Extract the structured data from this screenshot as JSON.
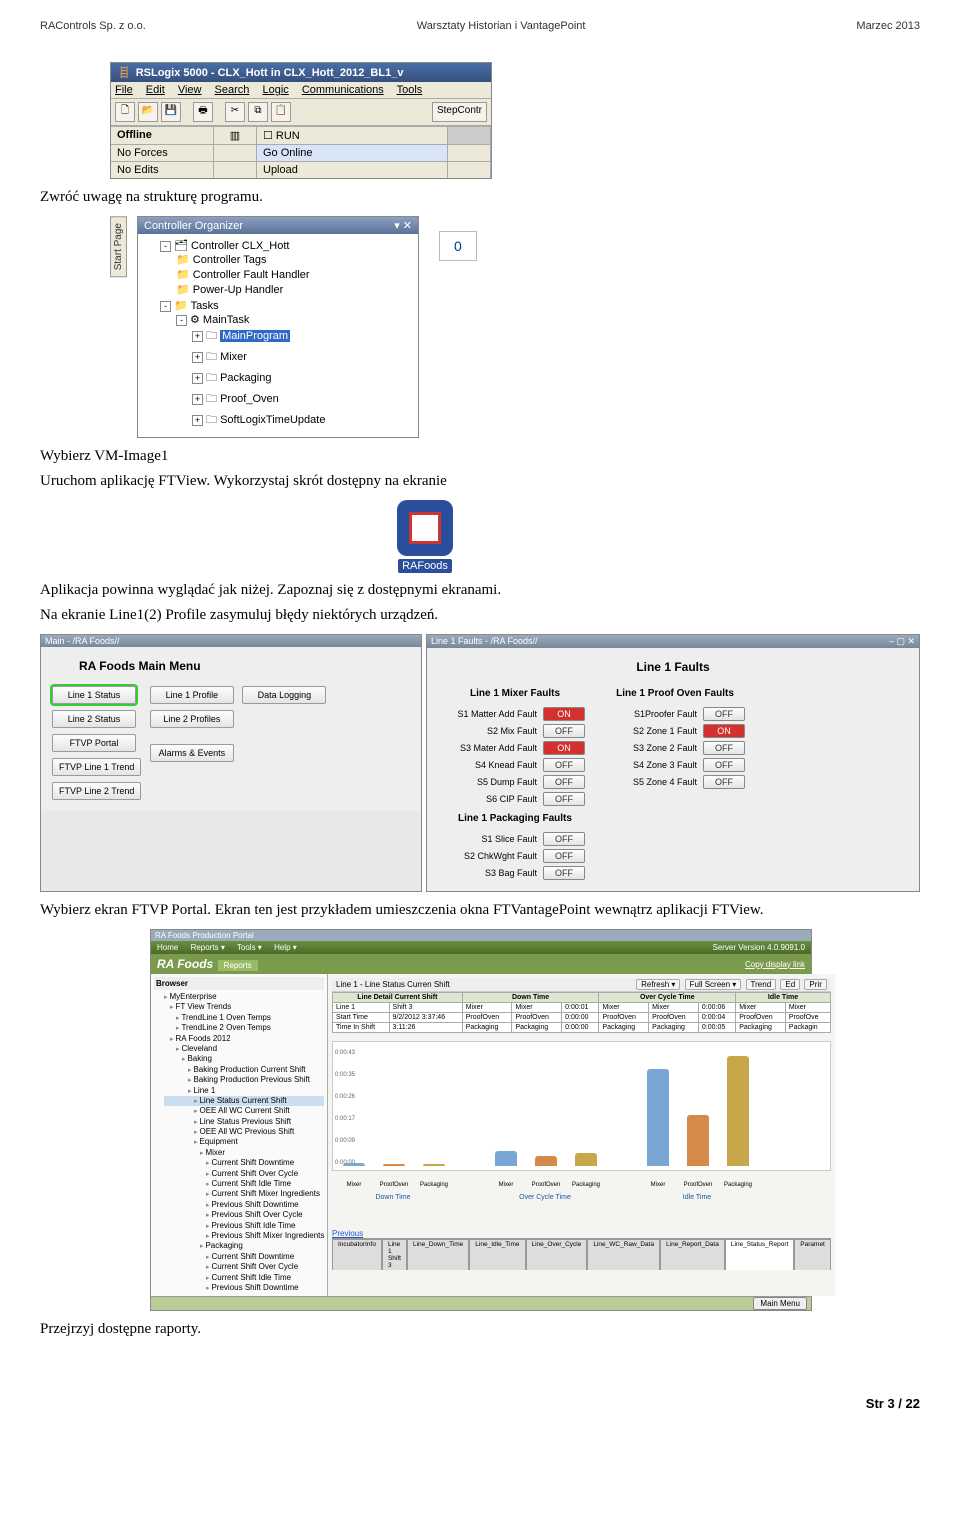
{
  "header": {
    "left": "RAControls Sp. z o.o.",
    "center": "Warsztaty  Historian i VantagePoint",
    "right": "Marzec 2013"
  },
  "rslogix": {
    "title": "RSLogix 5000 - CLX_Hott in CLX_Hott_2012_BL1_v",
    "menu": [
      "File",
      "Edit",
      "View",
      "Search",
      "Logic",
      "Communications",
      "Tools"
    ],
    "toolbar_right_btn": "StepContr",
    "status": {
      "offline": "Offline",
      "run": "RUN",
      "noforces": "No Forces",
      "goonline": "Go Online",
      "noedits": "No Edits",
      "upload": "Upload"
    }
  },
  "para1": "Zwróć uwagę na strukturę programu.",
  "organizer": {
    "start_tab": "Start Page",
    "title": "Controller Organizer",
    "pin_glyphs": "▾ ✕",
    "tree": {
      "controller": "Controller CLX_Hott",
      "items": [
        "Controller Tags",
        "Controller Fault Handler",
        "Power-Up Handler"
      ],
      "tasks": "Tasks",
      "maintask": "MainTask",
      "programs": [
        "MainProgram",
        "Mixer",
        "Packaging",
        "Proof_Oven",
        "SoftLogixTimeUpdate"
      ]
    },
    "side_value": "0"
  },
  "para2a": "Wybierz VM-Image1",
  "para2b": "Uruchom aplikację FTView. Wykorzystaj skrót dostępny na ekranie",
  "rafoods_label": "RAFoods",
  "para3a": "Aplikacja powinna wyglądać jak niżej. Zapoznaj się z dostępnymi ekranami.",
  "para3b": "Na ekranie Line1(2) Profile zasymuluj błędy niektórych urządzeń.",
  "ftview_left": {
    "title_prefix": "Main - /RA Foods//",
    "heading": "RA Foods Main Menu",
    "col1": [
      "Line 1 Status",
      "Line 2 Status",
      "FTVP Portal",
      "FTVP Line 1 Trend",
      "FTVP Line 2 Trend"
    ],
    "col2": [
      "Line 1 Profile",
      "Line 2 Profiles",
      "Alarms & Events"
    ],
    "col3": [
      "Data Logging"
    ]
  },
  "ftview_right": {
    "title_prefix": "Line 1 Faults - /RA Foods//",
    "heading": "Line 1 Faults",
    "groups": [
      {
        "title": "Line 1 Mixer Faults",
        "rows": [
          {
            "lbl": "S1 Matter Add Fault",
            "state": "ON"
          },
          {
            "lbl": "S2 Mix Fault",
            "state": "OFF"
          },
          {
            "lbl": "S3 Mater Add Fault",
            "state": "ON"
          },
          {
            "lbl": "S4 Knead Fault",
            "state": "OFF"
          },
          {
            "lbl": "S5 Dump Fault",
            "state": "OFF"
          },
          {
            "lbl": "S6 CIP Fault",
            "state": "OFF"
          }
        ]
      },
      {
        "title": "Line 1 Proof Oven Faults",
        "rows": [
          {
            "lbl": "S1Proofer Fault",
            "state": "OFF"
          },
          {
            "lbl": "S2 Zone 1 Fault",
            "state": "ON"
          },
          {
            "lbl": "S3 Zone 2 Fault",
            "state": "OFF"
          },
          {
            "lbl": "S4 Zone 3 Fault",
            "state": "OFF"
          },
          {
            "lbl": "S5 Zone 4 Fault",
            "state": "OFF"
          }
        ]
      },
      {
        "title": "Line 1 Packaging Faults",
        "rows": [
          {
            "lbl": "S1 Slice Fault",
            "state": "OFF"
          },
          {
            "lbl": "S2 ChkWght Fault",
            "state": "OFF"
          },
          {
            "lbl": "S3 Bag Fault",
            "state": "OFF"
          }
        ]
      }
    ]
  },
  "para4": "Wybierz ekran FTVP Portal. Ekran ten jest przykładem umieszczenia okna FTVantagePoint wewnątrz aplikacji FTView.",
  "portal": {
    "wintitle": "RA Foods Production Portal",
    "menus": [
      "Home",
      "Reports ▾",
      "Tools ▾",
      "Help ▾"
    ],
    "server_ver": "Server Version 4.0.9091.0",
    "brand": "RA Foods",
    "brand_sub": "Reports",
    "copy_link": "Copy display link",
    "browser_hdr": "Browser",
    "tree": [
      "MyEnterprise",
      " FT View Trends",
      "  TrendLine 1 Oven Temps",
      "  TrendLine 2 Oven Temps",
      " RA Foods 2012",
      "  Cleveland",
      "   Baking",
      "    Baking Production Current Shift",
      "    Baking Production Previous Shift",
      "    Line 1",
      "     Line Status Current Shift",
      "     OEE All WC Current Shift",
      "     Line Status Previous Shift",
      "     OEE All WC Previous Shift",
      "     Equipment",
      "      Mixer",
      "       Current Shift Downtime",
      "       Current Shift Over Cycle",
      "       Current Shift Idle Time",
      "       Current Shift Mixer Ingredients",
      "       Previous Shift Downtime",
      "       Previous Shift Over Cycle",
      "       Previous Shift Idle Time",
      "       Previous Shift Mixer Ingredients",
      "      Packaging",
      "       Current Shift Downtime",
      "       Current Shift Over Cycle",
      "       Current Shift Idle Time",
      "       Previous Shift Downtime"
    ],
    "tree_selected_idx": 10,
    "toolbar": {
      "left": "Line 1 - Line Status Curren Shift",
      "refresh": "Refresh ▾",
      "fullscreen": "Full Screen ▾",
      "trend": "Trend",
      "edit": "Ed",
      "print": "Prir"
    },
    "detail": {
      "headers": [
        "Line Detail Current Shift",
        "Down Time",
        "Over Cycle Time",
        "Idle Time"
      ],
      "rows": [
        [
          "Line 1",
          "Shift 3",
          "Mixer",
          "Mixer",
          "0:00:01",
          "Mixer",
          "Mixer",
          "0:00:06",
          "Mixer",
          "Mixer"
        ],
        [
          "Start Time",
          "9/2/2012 3:37:46",
          "ProofOven",
          "ProofOven",
          "0:00:00",
          "ProofOven",
          "ProofOven",
          "0:00:04",
          "ProofOven",
          "ProofOve"
        ],
        [
          "Time In Shift",
          "3:11:26",
          "Packaging",
          "Packaging",
          "0:00:00",
          "Packaging",
          "Packaging",
          "0:00:05",
          "Packaging",
          "Packagin"
        ]
      ]
    },
    "ylabels": [
      "0:00:43",
      "0:00:35",
      "0:00:26",
      "0:00:17",
      "0:00:09",
      "0:00:00"
    ],
    "prev": "Previous",
    "tabs": [
      "IncubatorInfo",
      "Line 1 Shift 3",
      "Line_Down_Time",
      "Line_Idle_Time",
      "Line_Over_Cycle",
      "Line_WC_Raw_Data",
      "Line_Report_Data",
      "Line_Status_Report",
      "Paramet"
    ],
    "active_tab_idx": 7,
    "main_menu_btn": "Main Menu"
  },
  "chart_data": {
    "type": "bar",
    "title": "",
    "y_format": "duration_seconds",
    "groups": [
      {
        "name": "Down Time",
        "categories": [
          "Mixer",
          "ProofOven",
          "Packaging"
        ],
        "values_sec": [
          1,
          0,
          0
        ],
        "colors": [
          "#7aa6d6",
          "#d68a4a",
          "#c7a74a"
        ]
      },
      {
        "name": "Over Cycle Time",
        "categories": [
          "Mixer",
          "ProofOven",
          "Packaging"
        ],
        "values_sec": [
          6,
          4,
          5
        ],
        "colors": [
          "#7aa6d6",
          "#d68a4a",
          "#c7a74a"
        ]
      },
      {
        "name": "Idle Time",
        "categories": [
          "Mixer",
          "ProofOven",
          "Packaging"
        ],
        "values_sec": [
          38,
          20,
          43
        ],
        "colors": [
          "#7aa6d6",
          "#d68a4a",
          "#c7a74a"
        ]
      }
    ],
    "ymax_sec": 43
  },
  "para5": "Przejrzyj dostępne raporty.",
  "footer": "Str 3 / 22"
}
